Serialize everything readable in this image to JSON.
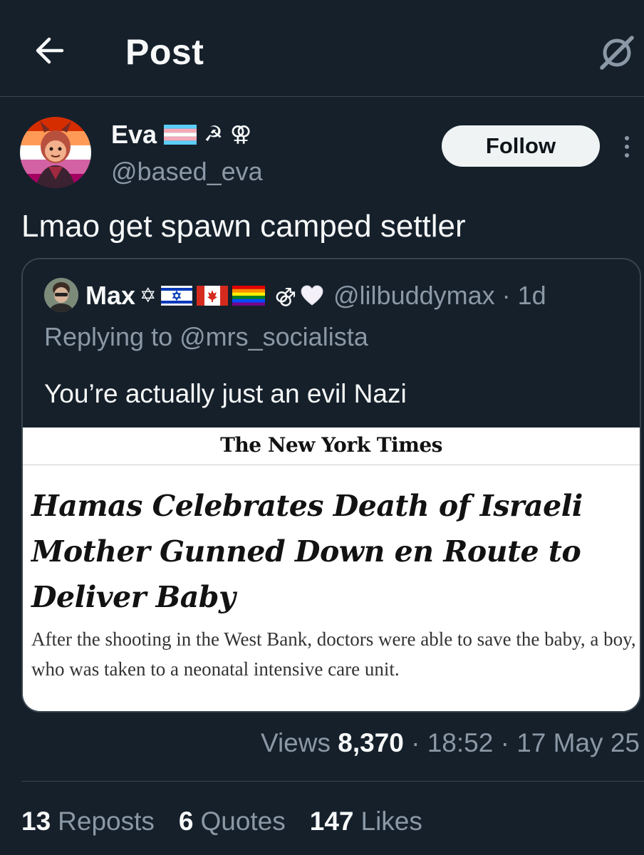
{
  "header": {
    "title": "Post",
    "back_icon": "arrow-left-icon",
    "grok_icon": "grok-icon"
  },
  "post": {
    "author": {
      "display_name": "Eva",
      "name_emojis": [
        "transgender-flag",
        "☭",
        "⚢"
      ],
      "handle": "@based_eva"
    },
    "follow_label": "Follow",
    "more_icon": "more-vertical-icon",
    "text": "Lmao get spawn camped settler"
  },
  "quote": {
    "author": {
      "display_name": "Max",
      "name_emojis": [
        "✡",
        "israel-flag",
        "canada-flag",
        "rainbow-flag",
        "⚣",
        "🤍"
      ],
      "handle": "@lilbuddymax",
      "time": "1d"
    },
    "replying_to": "Replying to @mrs_socialista",
    "text": "You’re actually just an evil Nazi",
    "article": {
      "publication": "The New York Times",
      "headline": "Hamas Celebrates Death of Israeli Mother Gunned Down en Route to Deliver Baby",
      "summary": "After the shooting in the West Bank, doctors were able to save the baby, a boy, who was taken to a neonatal intensive care unit."
    }
  },
  "meta": {
    "views_label": "Views",
    "views_count": "8,370",
    "time": "18:52",
    "date": "17 May 25"
  },
  "stats": {
    "reposts_count": "13",
    "reposts_label": "Reposts",
    "quotes_count": "6",
    "quotes_label": "Quotes",
    "likes_count": "147",
    "likes_label": "Likes"
  },
  "colors": {
    "background": "#15202b",
    "text": "#f7f9f9",
    "secondary_text": "#8b98a5",
    "border": "#38444d",
    "follow_button": "#eff3f4"
  }
}
